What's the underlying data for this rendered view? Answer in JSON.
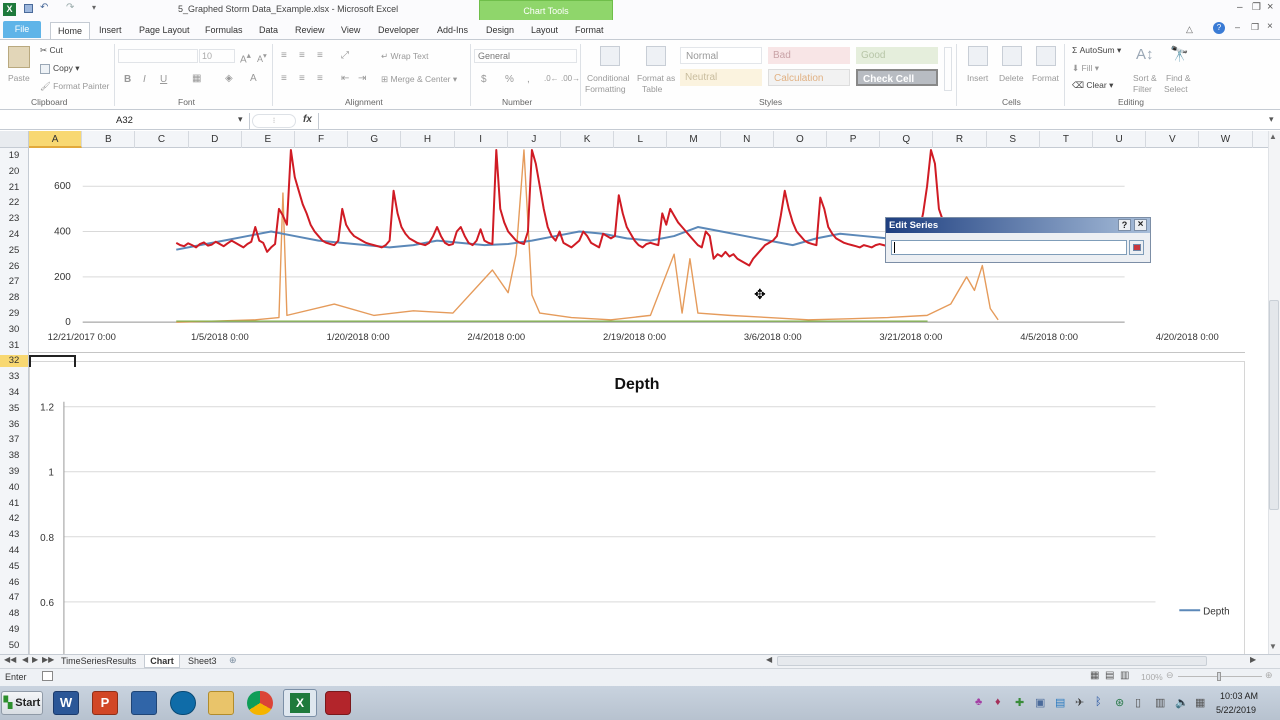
{
  "window": {
    "title": "5_Graphed Storm Data_Example.xlsx  -  Microsoft Excel",
    "chart_tools": "Chart Tools"
  },
  "ribbon_tabs": [
    "File",
    "Home",
    "Insert",
    "Page Layout",
    "Formulas",
    "Data",
    "Review",
    "View",
    "Developer",
    "Add-Ins",
    "Design",
    "Layout",
    "Format"
  ],
  "clipboard": {
    "paste": "Paste",
    "cut": "Cut",
    "copy": "Copy",
    "format_painter": "Format Painter",
    "group": "Clipboard"
  },
  "font": {
    "size": "10",
    "group": "Font",
    "bold": "B",
    "italic": "I",
    "underline": "U"
  },
  "alignment": {
    "wrap": "Wrap Text",
    "merge": "Merge & Center",
    "group": "Alignment"
  },
  "number": {
    "format": "General",
    "dollar": "$",
    "percent": "%",
    "comma": ",",
    "group": "Number"
  },
  "styles": {
    "conditional_l1": "Conditional",
    "conditional_l2": "Formatting",
    "format_table_l1": "Format as",
    "format_table_l2": "Table",
    "normal": "Normal",
    "bad": "Bad",
    "good": "Good",
    "neutral": "Neutral",
    "calculation": "Calculation",
    "check_cell": "Check Cell",
    "group": "Styles"
  },
  "cells": {
    "insert": "Insert",
    "delete": "Delete",
    "format": "Format",
    "group": "Cells"
  },
  "editing": {
    "autosum": "AutoSum",
    "fill": "Fill",
    "clear": "Clear",
    "sort_l1": "Sort &",
    "sort_l2": "Filter",
    "find_l1": "Find &",
    "find_l2": "Select",
    "group": "Editing"
  },
  "formula_bar": {
    "name_box": "A32",
    "fx": "fx",
    "value": ""
  },
  "columns": [
    "A",
    "B",
    "C",
    "D",
    "E",
    "F",
    "G",
    "H",
    "I",
    "J",
    "K",
    "L",
    "M",
    "N",
    "O",
    "P",
    "Q",
    "R",
    "S",
    "T",
    "U",
    "V",
    "W"
  ],
  "rows": [
    "19",
    "20",
    "21",
    "22",
    "23",
    "24",
    "25",
    "26",
    "27",
    "28",
    "29",
    "30",
    "31",
    "32",
    "33",
    "34",
    "35",
    "36",
    "37",
    "38",
    "39",
    "40",
    "41",
    "42",
    "43",
    "44",
    "45",
    "46",
    "47",
    "48",
    "49",
    "50"
  ],
  "chart_data": [
    {
      "type": "line",
      "title": "",
      "y_ticks": [
        "0",
        "200",
        "400",
        "600"
      ],
      "ylim": [
        0,
        760
      ],
      "x_ticks": [
        "12/21/2017 0:00",
        "1/5/2018 0:00",
        "1/20/2018 0:00",
        "2/4/2018 0:00",
        "2/19/2018 0:00",
        "3/6/2018 0:00",
        "3/21/2018 0:00",
        "4/5/2018 0:00",
        "4/20/2018 0:00"
      ],
      "grid": true,
      "colors": {
        "red": "#d01b24",
        "blue": "#5b88b8",
        "orange": "#e59b5b",
        "green": "#7fb24a"
      },
      "series_red": {
        "x_days": [
          0,
          0.5,
          1,
          1.5,
          2,
          2.5,
          3,
          3.5,
          4,
          4.5,
          5,
          5.5,
          6,
          6.5,
          7,
          7.5,
          8,
          8.5,
          9,
          9.5,
          10,
          10.5,
          11,
          11.5,
          12,
          12.5,
          13,
          13.5,
          14,
          14.5,
          15,
          15.5,
          16,
          16.5,
          17,
          17.5,
          18,
          18.5,
          19,
          19.5,
          20,
          20.5,
          21,
          21.5,
          22,
          22.5,
          23,
          23.5,
          24,
          24.5,
          25,
          25.5,
          26,
          26.5,
          27,
          27.5,
          28,
          28.5,
          29,
          29.5,
          30,
          30.5,
          31,
          31.5,
          32,
          32.5,
          33,
          33.5,
          34,
          34.5,
          35,
          35.5,
          36,
          36.5,
          37,
          37.5,
          38,
          38.5,
          39,
          39.5,
          40,
          40.5,
          41,
          41.5,
          42,
          42.5,
          43,
          43.5,
          44,
          44.5,
          45,
          45.5,
          46,
          46.5,
          47,
          47.5,
          48,
          48.5,
          49,
          49.5,
          50,
          50.5,
          51,
          51.5,
          52,
          52.5,
          53,
          53.5,
          54,
          54.5,
          55,
          55.5,
          56,
          56.5,
          57,
          57.5,
          58,
          58.5,
          59,
          59.5,
          60,
          60.5,
          61,
          61.5,
          62,
          62.5,
          63,
          63.5,
          64,
          64.5,
          65,
          65.5,
          66,
          66.5,
          67,
          67.5,
          68,
          68.5,
          69,
          69.5,
          70,
          70.5,
          71,
          71.5,
          72,
          72.5,
          73,
          73.5,
          74,
          74.5,
          75,
          75.5,
          76,
          76.5,
          77,
          77.5,
          78,
          78.5,
          79,
          79.5,
          80,
          80.5,
          81,
          81.5,
          82,
          82.5,
          83,
          83.5,
          84,
          84.5,
          85,
          85.5,
          86,
          86.5,
          87,
          87.5,
          88,
          88.5,
          89,
          89.5,
          90,
          90.5,
          91,
          91.5,
          92,
          92.5,
          93,
          93.5,
          94,
          94.5,
          95,
          95.5,
          96,
          96.5,
          97,
          97.5,
          98,
          98.5,
          99,
          99.5,
          100,
          100.5,
          101,
          101.5,
          102,
          102.5
        ],
        "values": [
          350,
          340,
          335,
          348,
          340,
          330,
          345,
          352,
          338,
          342,
          355,
          345,
          335,
          348,
          360,
          350,
          340,
          330,
          345,
          355,
          420,
          360,
          350,
          310,
          330,
          345,
          500,
          470,
          430,
          760,
          640,
          580,
          520,
          480,
          430,
          400,
          380,
          360,
          350,
          345,
          340,
          360,
          500,
          430,
          400,
          380,
          370,
          360,
          350,
          345,
          340,
          335,
          330,
          340,
          360,
          580,
          480,
          420,
          390,
          370,
          360,
          350,
          345,
          340,
          350,
          380,
          420,
          380,
          350,
          340,
          345,
          400,
          420,
          380,
          350,
          340,
          360,
          410,
          360,
          350,
          345,
          900,
          500,
          440,
          400,
          380,
          360,
          350,
          345,
          400,
          850,
          700,
          600,
          500,
          420,
          380,
          360,
          400,
          350,
          340,
          330,
          345,
          360,
          400,
          380,
          350,
          340,
          330,
          390,
          380,
          370,
          380,
          560,
          480,
          420,
          390,
          360,
          340,
          330,
          345,
          350,
          345,
          340,
          480,
          430,
          500,
          470,
          440,
          420,
          400,
          380,
          360,
          340,
          330,
          400,
          380,
          280,
          300,
          290,
          310,
          290,
          300,
          280,
          270,
          260,
          250,
          280,
          300,
          320,
          340,
          350,
          360,
          380,
          470,
          580,
          500,
          440,
          400,
          380,
          360,
          350,
          345,
          340,
          550,
          500,
          420,
          390,
          370,
          360,
          350,
          345,
          340,
          335,
          330,
          340,
          335,
          330,
          340,
          345,
          340,
          335,
          330,
          345,
          340,
          335,
          330,
          340,
          360,
          400,
          480,
          600,
          900,
          700,
          500,
          450,
          400
        ]
      },
      "series_blue": {
        "x_days": [
          0,
          3,
          6,
          9,
          12,
          15,
          18,
          21,
          24,
          27,
          30,
          33,
          36,
          39,
          42,
          45,
          48,
          51,
          54,
          57,
          60,
          63,
          66,
          69,
          72,
          75,
          78,
          81,
          84,
          87,
          90,
          93,
          96,
          99,
          102
        ],
        "values": [
          320,
          340,
          360,
          380,
          400,
          380,
          360,
          350,
          340,
          330,
          340,
          360,
          350,
          340,
          345,
          360,
          380,
          400,
          390,
          370,
          360,
          380,
          420,
          400,
          380,
          360,
          340,
          370,
          390,
          380,
          370,
          360,
          380,
          420,
          420
        ]
      },
      "series_orange": {
        "x_days": [
          0,
          5,
          10,
          13,
          13.5,
          14,
          20,
          25,
          30,
          35,
          40,
          42,
          43,
          44,
          45,
          46,
          50,
          55,
          60,
          63,
          64,
          65,
          66,
          70,
          75,
          80,
          85,
          90,
          95,
          98,
          100,
          101,
          102,
          103,
          104
        ],
        "values": [
          0,
          5,
          10,
          20,
          570,
          30,
          80,
          30,
          50,
          40,
          230,
          130,
          300,
          900,
          120,
          40,
          20,
          10,
          30,
          300,
          40,
          280,
          40,
          30,
          20,
          10,
          15,
          20,
          30,
          80,
          200,
          140,
          250,
          60,
          10
        ]
      }
    },
    {
      "type": "line",
      "title": "Depth",
      "y_ticks": [
        "0.6",
        "0.8",
        "1",
        "1.2"
      ],
      "ylim": [
        0.5,
        1.2
      ],
      "series": [
        {
          "name": "Depth",
          "values": []
        }
      ],
      "legend": "right",
      "grid": true
    }
  ],
  "dialog": {
    "title": "Edit Series",
    "help": "?",
    "close": "×",
    "input_value": ""
  },
  "sheet_tabs": [
    "TimeSeriesResults",
    "Chart",
    "Sheet3"
  ],
  "status": {
    "mode": "Enter",
    "zoom": "100%"
  },
  "taskbar": {
    "start": "Start",
    "time": "10:03 AM",
    "date": "5/22/2019"
  }
}
